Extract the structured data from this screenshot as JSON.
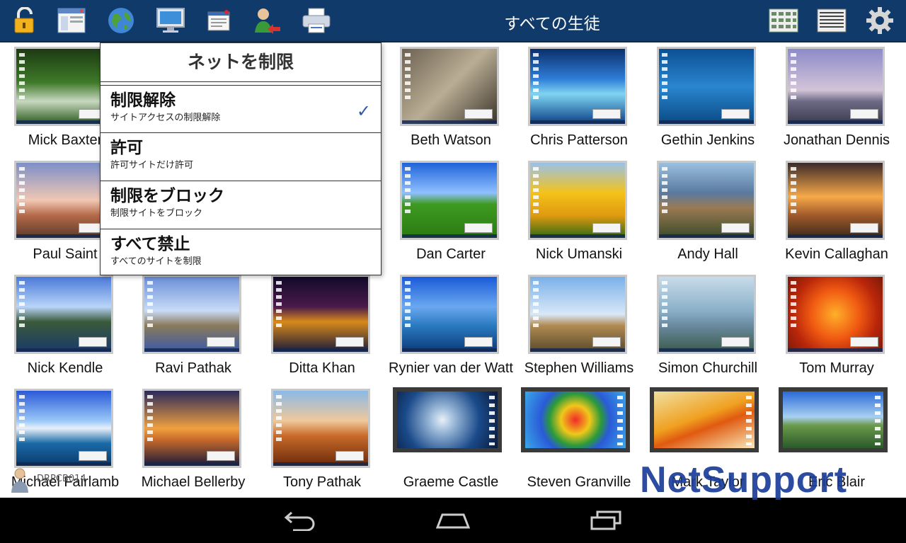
{
  "header": {
    "title": "すべての生徒",
    "icons": [
      "lock-icon",
      "window-icon",
      "globe-icon",
      "monitor-icon",
      "message-icon",
      "user-transfer-icon",
      "printer-icon",
      "grid-large-icon",
      "grid-small-icon",
      "gear-icon"
    ]
  },
  "menu": {
    "title": "ネットを制限",
    "items": [
      {
        "label": "制限解除",
        "desc": "サイトアクセスの制限解除",
        "checked": true
      },
      {
        "label": "許可",
        "desc": "許可サイトだけ許可"
      },
      {
        "label": "制限をブロック",
        "desc": "制限サイトをブロック"
      },
      {
        "label": "すべて禁止",
        "desc": "すべてのサイトを制限"
      }
    ]
  },
  "students": [
    {
      "name": "Mick Baxter"
    },
    {
      "name": ""
    },
    {
      "name": ""
    },
    {
      "name": "Beth Watson"
    },
    {
      "name": "Chris Patterson"
    },
    {
      "name": "Gethin Jenkins"
    },
    {
      "name": "Jonathan Dennis"
    },
    {
      "name": "Paul Saint"
    },
    {
      "name": ""
    },
    {
      "name": ""
    },
    {
      "name": "Dan Carter"
    },
    {
      "name": "Nick Umanski"
    },
    {
      "name": "Andy Hall"
    },
    {
      "name": "Kevin Callaghan"
    },
    {
      "name": "Nick Kendle"
    },
    {
      "name": "Ravi Pathak"
    },
    {
      "name": "Ditta Khan"
    },
    {
      "name": "Rynier van der Watt"
    },
    {
      "name": "Stephen Williams"
    },
    {
      "name": "Simon Churchill"
    },
    {
      "name": "Tom Murray"
    },
    {
      "name": "Michael Fairlamb"
    },
    {
      "name": "Michael Bellerby"
    },
    {
      "name": "Tony Pathak"
    },
    {
      "name": "Graeme Castle"
    },
    {
      "name": "Steven Granville"
    },
    {
      "name": "Mark Taylor"
    },
    {
      "name": "Eric Blair"
    }
  ],
  "watermark": "DRPCB014",
  "brand": "NetSupport",
  "colors": {
    "header": "#0f3a6a",
    "accent": "#2e57a8",
    "brand": "#1a3d9a"
  }
}
